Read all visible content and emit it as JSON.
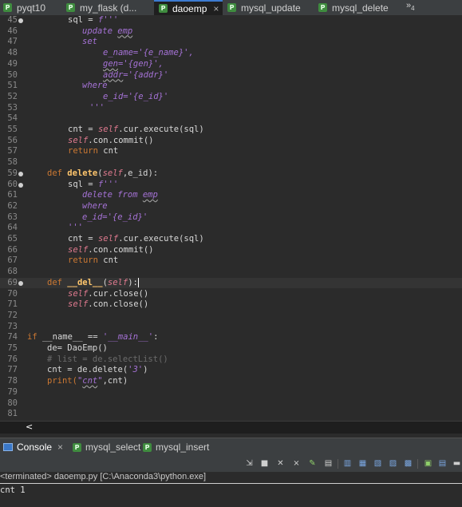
{
  "tabs": [
    {
      "label": "pyqt10",
      "active": false
    },
    {
      "label": "my_flask (d...",
      "active": false
    },
    {
      "label": "daoemp",
      "active": true
    },
    {
      "label": "mysql_update",
      "active": false
    },
    {
      "label": "mysql_delete",
      "active": false
    }
  ],
  "tab_icon": "P",
  "tab_close_glyph": "×",
  "overflow": {
    "glyph": "»",
    "count": "4"
  },
  "editor": {
    "lines": {
      "l45": "45",
      "l46": "46",
      "l47": "47",
      "l48": "48",
      "l49": "49",
      "l50": "50",
      "l51": "51",
      "l52": "52",
      "l53": "53",
      "l54": "54",
      "l55": "55",
      "l56": "56",
      "l57": "57",
      "l58": "58",
      "l59": "59",
      "l60": "60",
      "l61": "61",
      "l62": "62",
      "l63": "63",
      "l64": "64",
      "l65": "65",
      "l66": "66",
      "l67": "67",
      "l68": "68",
      "l69": "69",
      "l70": "70",
      "l71": "71",
      "l72": "72",
      "l73": "73",
      "l74": "74",
      "l75": "75",
      "l76": "76",
      "l77": "77",
      "l78": "78",
      "l79": "79",
      "l80": "80",
      "l81": "81"
    },
    "t": {
      "sql": "sql",
      "eq": " = ",
      "fstr_open": "f'''",
      "fstr_close": "'''",
      "update_emp_a": "update ",
      "emp": "emp",
      "set": "set",
      "ename_a": "e_name='{e_name}',",
      "gen": "gen",
      "gen_b": "='{gen}',",
      "addr": "addr",
      "addr_b": "='{addr}'",
      "where": "where",
      "eid": "e_id='{e_id}'",
      "cnt": "cnt",
      "self": "self",
      "cur_execute": ".cur.execute(sql)",
      "con_commit": ".con.commit()",
      "return": "return",
      "cnt_tail": " cnt",
      "def": "def",
      "delete": "delete",
      "delete_sig_a": "(",
      "delete_sig_b": ",e_id):",
      "delete_from_a": "delete from ",
      "del_fn": "__del__",
      "del_sig_a": "(",
      "del_sig_b": "):",
      "cur_close": ".cur.close()",
      "con_close": ".con.close()",
      "if": "if",
      "name_cmp": " __name__ == ",
      "main_str": "'__main__'",
      "colon": ":",
      "de_assign": "de= DaoEmp()",
      "comment": "# list = de.selectList()",
      "cnt_del_a": "cnt = de.delete(",
      "three": "'3'",
      "close_paren": ")",
      "print": "print(",
      "q_open": "\"",
      "cnt_word": "cnt",
      "q_close": "\"",
      "print_tail": ",cnt)"
    }
  },
  "scroll_arrow": "<",
  "console_tabs": [
    {
      "label": "Console",
      "active": true
    },
    {
      "label": "mysql_select",
      "active": false
    },
    {
      "label": "mysql_insert",
      "active": false
    }
  ],
  "console": {
    "terminated": "<terminated> daoemp.py [C:\\Anaconda3\\python.exe]",
    "output": "cnt 1"
  },
  "toolbar_icons": [
    "pin-icon",
    "terminate-icon",
    "remove-launch-icon",
    "remove-all-icon",
    "clear-icon",
    "scroll-lock-icon",
    "word-wrap-icon",
    "show-stdout-icon",
    "show-stderr-icon",
    "open-console-icon",
    "display-console-icon",
    "new-console-icon",
    "view-menu-icon"
  ],
  "colors": {
    "keyword": "#cc7832",
    "function": "#ffc66d",
    "self": "#e07a8f",
    "string": "#a572d6",
    "comment": "#6b6b6b",
    "accent": "#3c7bd1"
  }
}
